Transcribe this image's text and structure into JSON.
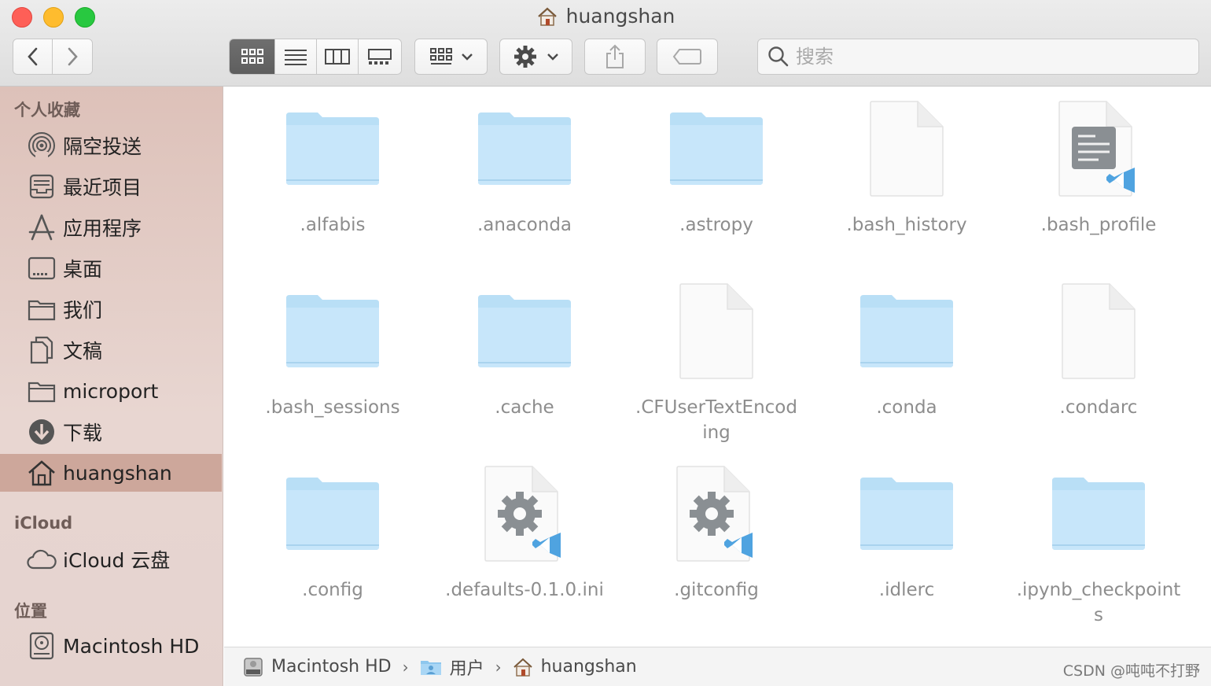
{
  "window": {
    "title": "huangshan"
  },
  "toolbar": {
    "search_placeholder": "搜索"
  },
  "sidebar": {
    "sections": [
      "个人收藏",
      "iCloud",
      "位置"
    ],
    "favorites": [
      {
        "label": "隔空投送",
        "icon": "airdrop-icon"
      },
      {
        "label": "最近项目",
        "icon": "recents-icon"
      },
      {
        "label": "应用程序",
        "icon": "applications-icon"
      },
      {
        "label": "桌面",
        "icon": "desktop-icon"
      },
      {
        "label": "我们",
        "icon": "folder-icon"
      },
      {
        "label": "文稿",
        "icon": "documents-icon"
      },
      {
        "label": "microport",
        "icon": "folder-icon"
      },
      {
        "label": "下载",
        "icon": "downloads-icon"
      },
      {
        "label": "huangshan",
        "icon": "home-icon",
        "selected": true
      }
    ],
    "icloud": [
      {
        "label": "iCloud 云盘",
        "icon": "cloud-icon"
      }
    ],
    "locations": [
      {
        "label": "Macintosh HD",
        "icon": "hard-drive-icon"
      }
    ]
  },
  "files": [
    {
      "name": ".alfabis",
      "type": "folder"
    },
    {
      "name": ".anaconda",
      "type": "folder"
    },
    {
      "name": ".astropy",
      "type": "folder"
    },
    {
      "name": ".bash_history",
      "type": "file"
    },
    {
      "name": ".bash_profile",
      "type": "vscode-text"
    },
    {
      "name": ".bash_sessions",
      "type": "folder"
    },
    {
      "name": ".cache",
      "type": "folder"
    },
    {
      "name": ".CFUserTextEncoding",
      "type": "file"
    },
    {
      "name": ".conda",
      "type": "folder"
    },
    {
      "name": ".condarc",
      "type": "file"
    },
    {
      "name": ".config",
      "type": "folder"
    },
    {
      "name": ".defaults-0.1.0.ini",
      "type": "vscode-gear"
    },
    {
      "name": ".gitconfig",
      "type": "vscode-gear"
    },
    {
      "name": ".idlerc",
      "type": "folder"
    },
    {
      "name": ".ipynb_checkpoints",
      "type": "folder"
    }
  ],
  "pathbar": {
    "crumbs": [
      {
        "label": "Macintosh HD",
        "icon": "hard-drive-icon"
      },
      {
        "label": "用户",
        "icon": "users-folder-icon"
      },
      {
        "label": "huangshan",
        "icon": "home-icon"
      }
    ],
    "separator": "›"
  },
  "watermark": "CSDN @吨吨不打野"
}
